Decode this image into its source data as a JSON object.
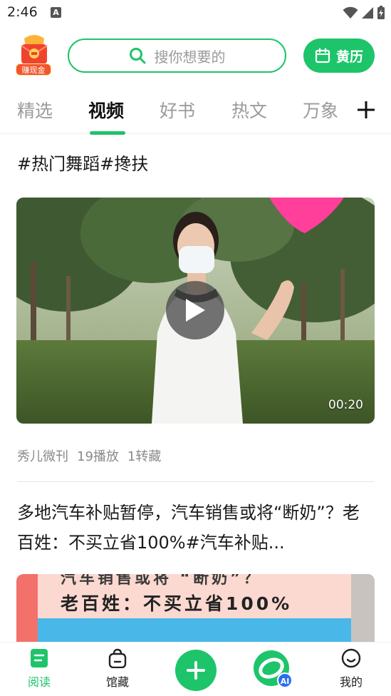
{
  "status_bar": {
    "time": "2:46",
    "notification_icon": "A",
    "icons": [
      "wifi-icon",
      "signal-icon",
      "battery-charging-icon"
    ]
  },
  "header": {
    "reward_label": "赚现金",
    "search_placeholder": "搜你想要的",
    "calendar_label": "黄历"
  },
  "tabs": [
    {
      "label": "精选",
      "active": false
    },
    {
      "label": "视频",
      "active": true
    },
    {
      "label": "好书",
      "active": false
    },
    {
      "label": "热文",
      "active": false
    },
    {
      "label": "万象",
      "active": false
    }
  ],
  "feed": {
    "item1": {
      "title": "#热门舞蹈#搀扶",
      "duration": "00:20",
      "source": "秀儿微刊",
      "plays": "19播放",
      "saves": "1转藏"
    },
    "item2": {
      "title": "多地汽车补贴暂停，汽车销售或将“断奶”？老百姓：不买立省100%#汽车补贴...",
      "thumb_line1": "汽车销售或将 “断奶”？",
      "thumb_line2": "老百姓：不买立省100%"
    }
  },
  "bottom_nav": [
    {
      "label": "阅读",
      "icon": "document-icon",
      "active": true
    },
    {
      "label": "馆藏",
      "icon": "bag-icon",
      "active": false
    },
    {
      "label": "",
      "icon": "plus-icon",
      "active": false
    },
    {
      "label": "AI",
      "icon": "ai-assistant-icon",
      "active": false
    },
    {
      "label": "我的",
      "icon": "smile-face-icon",
      "active": false
    }
  ],
  "colors": {
    "accent": "#1ec46a",
    "text_primary": "#1a1a1a",
    "text_secondary": "#8a8a8a"
  }
}
